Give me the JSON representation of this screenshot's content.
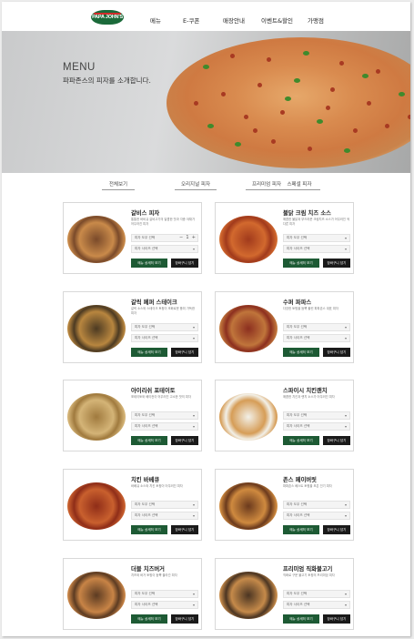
{
  "header": {
    "logo_text": "PAPA JOHN'S",
    "nav": [
      "메뉴",
      "E-쿠폰",
      "매장안내",
      "이벤트&할인",
      "가맹점"
    ]
  },
  "hero": {
    "title": "MENU",
    "subtitle": "파파존스의 피자를 소개합니다."
  },
  "filters": [
    "전체보기",
    "오리지널 피자",
    "프리미엄 피자",
    "스페셜 피자"
  ],
  "card_common": {
    "size_placeholder": "피자 도우 선택",
    "dough_placeholder": "피자 사이즈 선택",
    "detail_label": "메뉴 상세히 보기",
    "cart_label": "장바구니 담기"
  },
  "products": [
    {
      "name": "갈비스 피자",
      "desc": "통통한 바비큐 갈비고기의 달콤한 맛과 각종 야채가 어우러진 피자"
    },
    {
      "name": "불닭 크림 치즈 소스",
      "desc": "매콤한 불닭과 부드러운 크림치즈 소스가 어우러진 색다른 피자"
    },
    {
      "name": "갈릭 페퍼 스테이크",
      "desc": "갈릭 소스와 스테이크 토핑이 조화로운 풍미 가득한 피자"
    },
    {
      "name": "수퍼 파파스",
      "desc": "다양한 토핑을 듬뿍 올린 파파존스 대표 피자"
    },
    {
      "name": "아이리쉬 포테이토",
      "desc": "포테이토와 베이컨이 어우러진 고소한 맛의 피자"
    },
    {
      "name": "스파이시 치킨랜치",
      "desc": "매콤한 치킨과 랜치 소스가 어우러진 피자"
    },
    {
      "name": "치킨 바베큐",
      "desc": "바베큐 소스와 치킨 토핑이 어우러진 피자"
    },
    {
      "name": "존스 페이버릿",
      "desc": "파파존스 베스트 토핑을 모은 인기 피자"
    },
    {
      "name": "더블 치즈버거",
      "desc": "치즈와 버거 토핑이 듬뿍 올라간 피자"
    },
    {
      "name": "프리미엄 직화불고기",
      "desc": "직화로 구운 불고기 토핑의 프리미엄 피자"
    }
  ]
}
